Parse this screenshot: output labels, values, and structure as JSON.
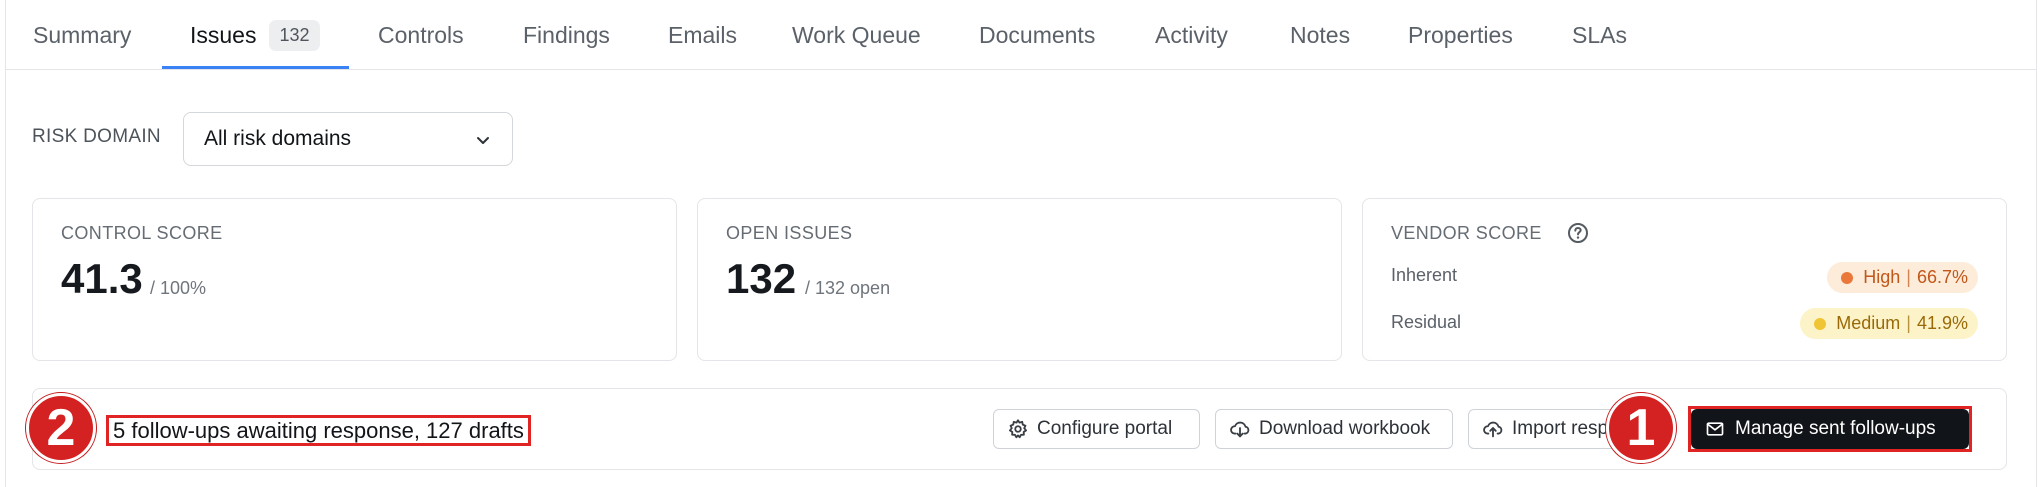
{
  "tabs": [
    {
      "label": "Summary"
    },
    {
      "label": "Issues",
      "count": "132",
      "active": true
    },
    {
      "label": "Controls"
    },
    {
      "label": "Findings"
    },
    {
      "label": "Emails"
    },
    {
      "label": "Work Queue"
    },
    {
      "label": "Documents"
    },
    {
      "label": "Activity"
    },
    {
      "label": "Notes"
    },
    {
      "label": "Properties"
    },
    {
      "label": "SLAs"
    }
  ],
  "filter": {
    "label": "RISK DOMAIN",
    "value": "All risk domains"
  },
  "cards": {
    "control_score": {
      "title": "CONTROL SCORE",
      "value": "41.3",
      "sub": "/ 100%"
    },
    "open_issues": {
      "title": "OPEN ISSUES",
      "value": "132",
      "sub": "/ 132 open"
    },
    "vendor_score": {
      "title": "VENDOR SCORE",
      "inherent": {
        "label": "Inherent",
        "level": "High",
        "pct": "66.7%"
      },
      "residual": {
        "label": "Residual",
        "level": "Medium",
        "pct": "41.9%"
      }
    }
  },
  "followups": {
    "status_text": "5 follow-ups awaiting response, 127 drafts",
    "buttons": {
      "configure": "Configure portal",
      "download": "Download workbook",
      "import": "Import responses",
      "manage": "Manage sent follow-ups"
    }
  },
  "markers": {
    "one": "1",
    "two": "2"
  },
  "colors": {
    "accent": "#3b82f6",
    "high": "#e9783a",
    "medium": "#f0c534",
    "annotation": "#e02424"
  }
}
